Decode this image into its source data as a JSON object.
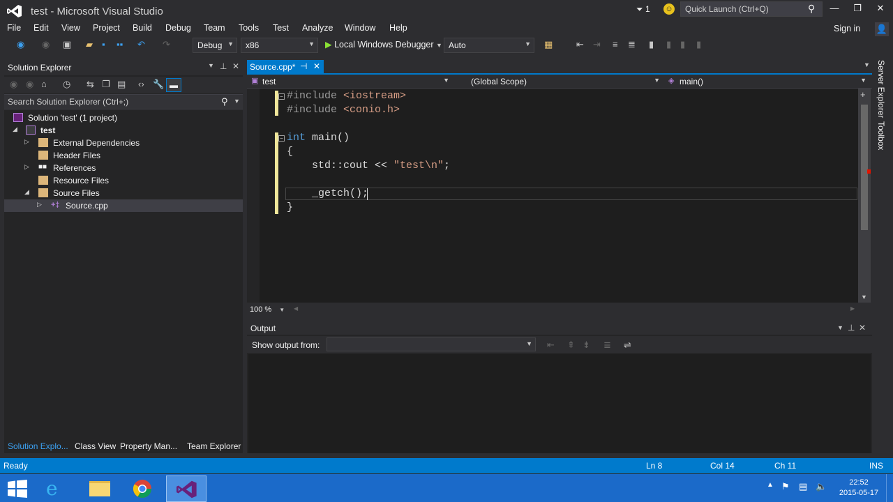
{
  "window": {
    "title": "test - Microsoft Visual Studio",
    "notification_count": "1",
    "quick_launch_placeholder": "Quick Launch (Ctrl+Q)"
  },
  "menu": {
    "items": [
      "File",
      "Edit",
      "View",
      "Project",
      "Build",
      "Debug",
      "Team",
      "Tools",
      "Test",
      "Analyze",
      "Window",
      "Help"
    ],
    "signin": "Sign in"
  },
  "toolbar": {
    "configuration": "Debug",
    "platform": "x86",
    "debugger": "Local Windows Debugger",
    "debugger_mode": "Auto"
  },
  "solution_explorer": {
    "title": "Solution Explorer",
    "search_placeholder": "Search Solution Explorer (Ctrl+;)",
    "tree": [
      {
        "label": "Solution 'test' (1 project)"
      },
      {
        "label": "test"
      },
      {
        "label": "External Dependencies"
      },
      {
        "label": "Header Files"
      },
      {
        "label": "References"
      },
      {
        "label": "Resource Files"
      },
      {
        "label": "Source Files"
      },
      {
        "label": "Source.cpp"
      }
    ],
    "bottom_tabs": [
      "Solution Explo...",
      "Class View",
      "Property Man...",
      "Team Explorer"
    ]
  },
  "editor": {
    "tab_label": "Source.cpp*",
    "nav": {
      "project": "test",
      "scope": "(Global Scope)",
      "member": "main()"
    },
    "code": {
      "line1_pp": "#include",
      "line1_hdr": " <iostream>",
      "line2_pp": "#include",
      "line2_hdr": " <conio.h>",
      "line4_kw": "int",
      "line4_rest": " main()",
      "line5": "{",
      "line6_a": "    std::cout << ",
      "line6_str": "\"test\\n\"",
      "line6_b": ";",
      "line8": "    _getch();",
      "line9": "}"
    },
    "zoom": "100 %"
  },
  "right_rail": [
    "Server Explorer",
    "Toolbox"
  ],
  "output": {
    "title": "Output",
    "show_from_label": "Show output from:"
  },
  "status": {
    "ready": "Ready",
    "ln": "Ln 8",
    "col": "Col 14",
    "ch": "Ch 11",
    "mode": "INS"
  },
  "taskbar": {
    "clock_time": "22:52",
    "clock_date": "2015-05-17"
  },
  "colors": {
    "accent": "#007acc",
    "background": "#2d2d30",
    "editor": "#1e1e1e",
    "keyword": "#569cd6",
    "string": "#d69d85"
  }
}
